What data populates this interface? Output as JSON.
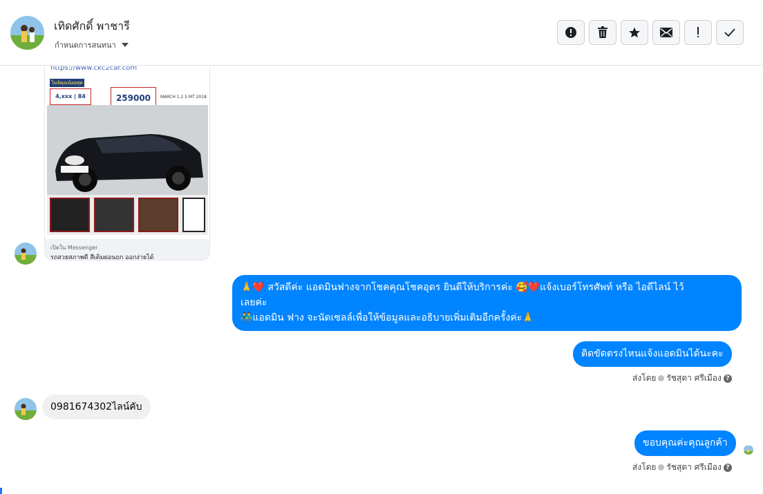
{
  "header": {
    "name": "เทิดศักดิ์ พาชารี",
    "assign_label": "กำหนดการสนทนา",
    "actions": [
      "mark-spam",
      "delete",
      "star",
      "email",
      "important",
      "done"
    ]
  },
  "card": {
    "url": "https://www.ckc2car.com",
    "badge": "ไมล์คุณน้อยสุด",
    "km": "4,xxx | 84",
    "price": "259000",
    "date_text": "MARCH 1.2 S MT 2018",
    "footer_label": "เปิดใน Messenger",
    "footer_text": "รถสวยสภาพดี สีเดิมผ่อนถูก ออกง่ายได้"
  },
  "messages": [
    {
      "id": "m1",
      "lines": [
        "🙏❤️ สวัสดีค่ะ แอดมินฟางจากโชคคุณโชคอุดร ยินดีให้บริการค่ะ  🥰❤️แจ้งเบอร์โทรศัพท์ หรือ ไอดีไลน์  ไว้",
        "เลยค่ะ",
        "👬แอดมิน ฟาง จะนัดเซลล์เพื่อให้ข้อมูลและอธิบายเพิ่มเติมอีกครั้งค่ะ🙏"
      ]
    },
    {
      "id": "m2",
      "text": "ติดขัดตรงไหนแจ้งแอดมินได้นะคะ"
    },
    {
      "id": "m3",
      "text": "0981674302ไลน์คับ"
    },
    {
      "id": "m4",
      "text": "ขอบคุณค่ะคุณลูกค้า"
    }
  ],
  "meta": {
    "sent_by_label": "ส่งโดย",
    "sender_name": "รัชสุดา ศรีเมือง",
    "help_glyph": "?"
  },
  "colors": {
    "outgoing_bubble": "#0084ff",
    "incoming_bubble": "#f0f0f0",
    "header_border": "#dddfe2"
  }
}
